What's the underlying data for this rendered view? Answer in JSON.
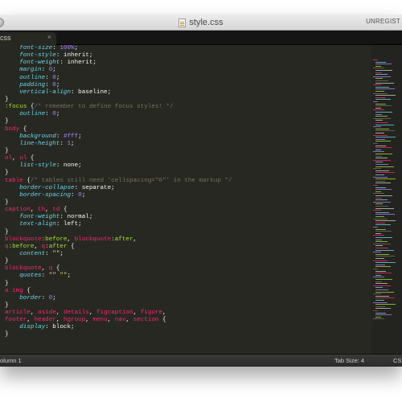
{
  "window": {
    "title": "style.css",
    "unregistered": "UNREGIST"
  },
  "tabs": [
    {
      "label": "css",
      "close": "×"
    }
  ],
  "status": {
    "position": "olumn 1",
    "tab_size": "Tab Size: 4",
    "syntax": "CS"
  },
  "colors": {
    "background": "#272822",
    "selector": "#f92672",
    "property": "#66d9ef",
    "value": "#ae81ff",
    "string": "#e6db74",
    "pseudo": "#a6e22e",
    "comment": "#75715e"
  },
  "code_lines": [
    [
      [
        "prop",
        "    font-size"
      ],
      [
        "punc",
        ": "
      ],
      [
        "val",
        "100%"
      ],
      [
        "punc",
        ";"
      ]
    ],
    [
      [
        "prop",
        "    font-style"
      ],
      [
        "punc",
        ": inherit;"
      ]
    ],
    [
      [
        "prop",
        "    font-weight"
      ],
      [
        "punc",
        ": inherit;"
      ]
    ],
    [
      [
        "prop",
        "    margin"
      ],
      [
        "punc",
        ": "
      ],
      [
        "val",
        "0"
      ],
      [
        "punc",
        ";"
      ]
    ],
    [
      [
        "prop",
        "    outline"
      ],
      [
        "punc",
        ": "
      ],
      [
        "val",
        "0"
      ],
      [
        "punc",
        ";"
      ]
    ],
    [
      [
        "prop",
        "    padding"
      ],
      [
        "punc",
        ": "
      ],
      [
        "val",
        "0"
      ],
      [
        "punc",
        ";"
      ]
    ],
    [
      [
        "prop",
        "    vertical-align"
      ],
      [
        "punc",
        ": baseline;"
      ]
    ],
    [
      [
        "punc",
        "}"
      ]
    ],
    [
      [
        "kw",
        ":focus"
      ],
      [
        "punc",
        " {"
      ],
      [
        "cmt",
        "/* remember to define focus styles! */"
      ]
    ],
    [
      [
        "prop",
        "    outline"
      ],
      [
        "punc",
        ": "
      ],
      [
        "val",
        "0"
      ],
      [
        "punc",
        ";"
      ]
    ],
    [
      [
        "punc",
        "}"
      ]
    ],
    [
      [
        "sel",
        "body"
      ],
      [
        "punc",
        " {"
      ]
    ],
    [
      [
        "prop",
        "    background"
      ],
      [
        "punc",
        ": "
      ],
      [
        "val",
        "#fff"
      ],
      [
        "punc",
        ";"
      ]
    ],
    [
      [
        "prop",
        "    line-height"
      ],
      [
        "punc",
        ": "
      ],
      [
        "val",
        "1"
      ],
      [
        "punc",
        ";"
      ]
    ],
    [
      [
        "punc",
        "}"
      ]
    ],
    [
      [
        "sel",
        "ol"
      ],
      [
        "punc",
        ", "
      ],
      [
        "sel",
        "ul"
      ],
      [
        "punc",
        " {"
      ]
    ],
    [
      [
        "prop",
        "    list-style"
      ],
      [
        "punc",
        ": none;"
      ]
    ],
    [
      [
        "punc",
        "}"
      ]
    ],
    [
      [
        "sel",
        "table"
      ],
      [
        "punc",
        " {"
      ],
      [
        "cmt",
        "/* tables still need 'cellspacing=\"0\"' in the markup */"
      ]
    ],
    [
      [
        "prop",
        "    border-collapse"
      ],
      [
        "punc",
        ": separate;"
      ]
    ],
    [
      [
        "prop",
        "    border-spacing"
      ],
      [
        "punc",
        ": "
      ],
      [
        "val",
        "0"
      ],
      [
        "punc",
        ";"
      ]
    ],
    [
      [
        "punc",
        "}"
      ]
    ],
    [
      [
        "sel",
        "caption"
      ],
      [
        "punc",
        ", "
      ],
      [
        "sel",
        "th"
      ],
      [
        "punc",
        ", "
      ],
      [
        "sel",
        "td"
      ],
      [
        "punc",
        " {"
      ]
    ],
    [
      [
        "prop",
        "    font-weight"
      ],
      [
        "punc",
        ": normal;"
      ]
    ],
    [
      [
        "prop",
        "    text-align"
      ],
      [
        "punc",
        ": left;"
      ]
    ],
    [
      [
        "punc",
        "}"
      ]
    ],
    [
      [
        "sel",
        "blockquote"
      ],
      [
        "kw",
        ":before"
      ],
      [
        "punc",
        ", "
      ],
      [
        "sel",
        "blockquote"
      ],
      [
        "kw",
        ":after"
      ],
      [
        "punc",
        ","
      ]
    ],
    [
      [
        "sel",
        "q"
      ],
      [
        "kw",
        ":before"
      ],
      [
        "punc",
        ", "
      ],
      [
        "sel",
        "q"
      ],
      [
        "kw",
        ":after"
      ],
      [
        "punc",
        " {"
      ]
    ],
    [
      [
        "prop",
        "    content"
      ],
      [
        "punc",
        ": "
      ],
      [
        "str",
        "\"\""
      ],
      [
        "punc",
        ";"
      ]
    ],
    [
      [
        "punc",
        "}"
      ]
    ],
    [
      [
        "sel",
        "blockquote"
      ],
      [
        "punc",
        ", "
      ],
      [
        "sel",
        "q"
      ],
      [
        "punc",
        " {"
      ]
    ],
    [
      [
        "prop",
        "    quotes"
      ],
      [
        "punc",
        ": "
      ],
      [
        "str",
        "\"\" \"\""
      ],
      [
        "punc",
        ";"
      ]
    ],
    [
      [
        "punc",
        "}"
      ]
    ],
    [
      [
        "sel",
        "a img"
      ],
      [
        "punc",
        " {"
      ]
    ],
    [
      [
        "prop",
        "    border"
      ],
      [
        "punc",
        ": "
      ],
      [
        "val",
        "0"
      ],
      [
        "punc",
        ";"
      ]
    ],
    [
      [
        "punc",
        "}"
      ]
    ],
    [
      [
        "sel",
        "article"
      ],
      [
        "punc",
        ", "
      ],
      [
        "sel",
        "aside"
      ],
      [
        "punc",
        ", "
      ],
      [
        "sel",
        "details"
      ],
      [
        "punc",
        ", "
      ],
      [
        "sel",
        "figcaption"
      ],
      [
        "punc",
        ", "
      ],
      [
        "sel",
        "figure"
      ],
      [
        "punc",
        ","
      ]
    ],
    [
      [
        "sel",
        "footer"
      ],
      [
        "punc",
        ", "
      ],
      [
        "sel",
        "header"
      ],
      [
        "punc",
        ", "
      ],
      [
        "sel",
        "hgroup"
      ],
      [
        "punc",
        ", "
      ],
      [
        "sel",
        "menu"
      ],
      [
        "punc",
        ", "
      ],
      [
        "sel",
        "nav"
      ],
      [
        "punc",
        ", "
      ],
      [
        "sel",
        "section"
      ],
      [
        "punc",
        " {"
      ]
    ],
    [
      [
        "prop",
        "    display"
      ],
      [
        "punc",
        ": block;"
      ]
    ],
    [
      [
        "punc",
        "}"
      ]
    ]
  ]
}
